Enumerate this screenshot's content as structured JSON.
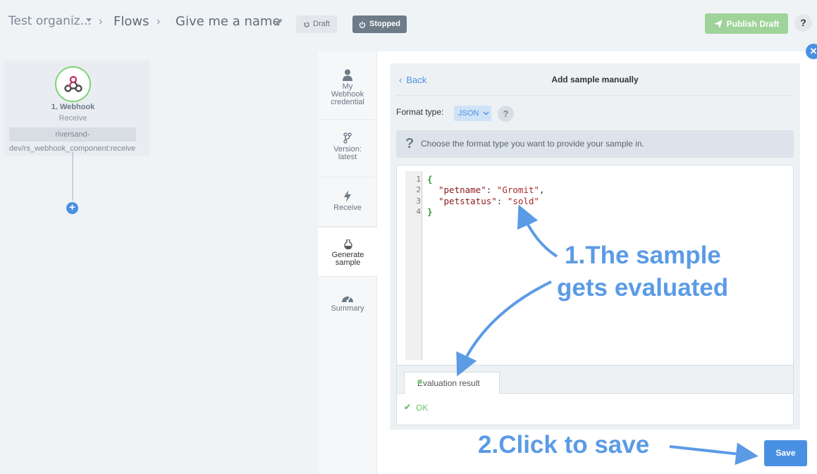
{
  "topbar": {
    "org": "Test organiz...",
    "sep": "›",
    "flows": "Flows",
    "flow_name": "Give me a name",
    "draft_label": "Draft",
    "stopped_label": "Stopped",
    "publish_label": "Publish Draft",
    "help_label": "?"
  },
  "node": {
    "title": "1. Webhook",
    "subtitle": "Receive",
    "strip": "riversand-",
    "path": "dev/rs_webhook_component:receive",
    "plus": "+"
  },
  "panel": {
    "close": "✕",
    "tabs": [
      {
        "label": "My Webhook credential",
        "icon": "user-icon"
      },
      {
        "label": "Version: latest",
        "icon": "branch-icon"
      },
      {
        "label": "Receive",
        "icon": "bolt-icon"
      },
      {
        "label": "Generate sample",
        "icon": "flask-icon"
      },
      {
        "label": "Summary",
        "icon": "gauge-icon"
      }
    ]
  },
  "content": {
    "back_label": "Back",
    "title": "Add sample manually",
    "format_label": "Format type:",
    "format_value": "JSON",
    "format_help": "?",
    "info_text": "Choose the format type you want to provide your sample in.",
    "code_lines": [
      {
        "num": "1",
        "text": "{"
      },
      {
        "num": "2",
        "key": "\"petname\"",
        "value": "\"Gromit\"",
        "trail": ","
      },
      {
        "num": "3",
        "key": "\"petstatus\"",
        "value": "\"sold\"",
        "trail": ""
      },
      {
        "num": "4",
        "text": "}"
      }
    ],
    "eval_tab": "Evaluation result",
    "ok_label": "OK",
    "save_label": "Save"
  },
  "annotations": {
    "line1": "1.The sample",
    "line2": "gets evaluated",
    "line3": "2.Click to save"
  },
  "colors": {
    "accent": "#4a90e2",
    "success": "#7ed17a",
    "annotation": "#5b9be6"
  }
}
